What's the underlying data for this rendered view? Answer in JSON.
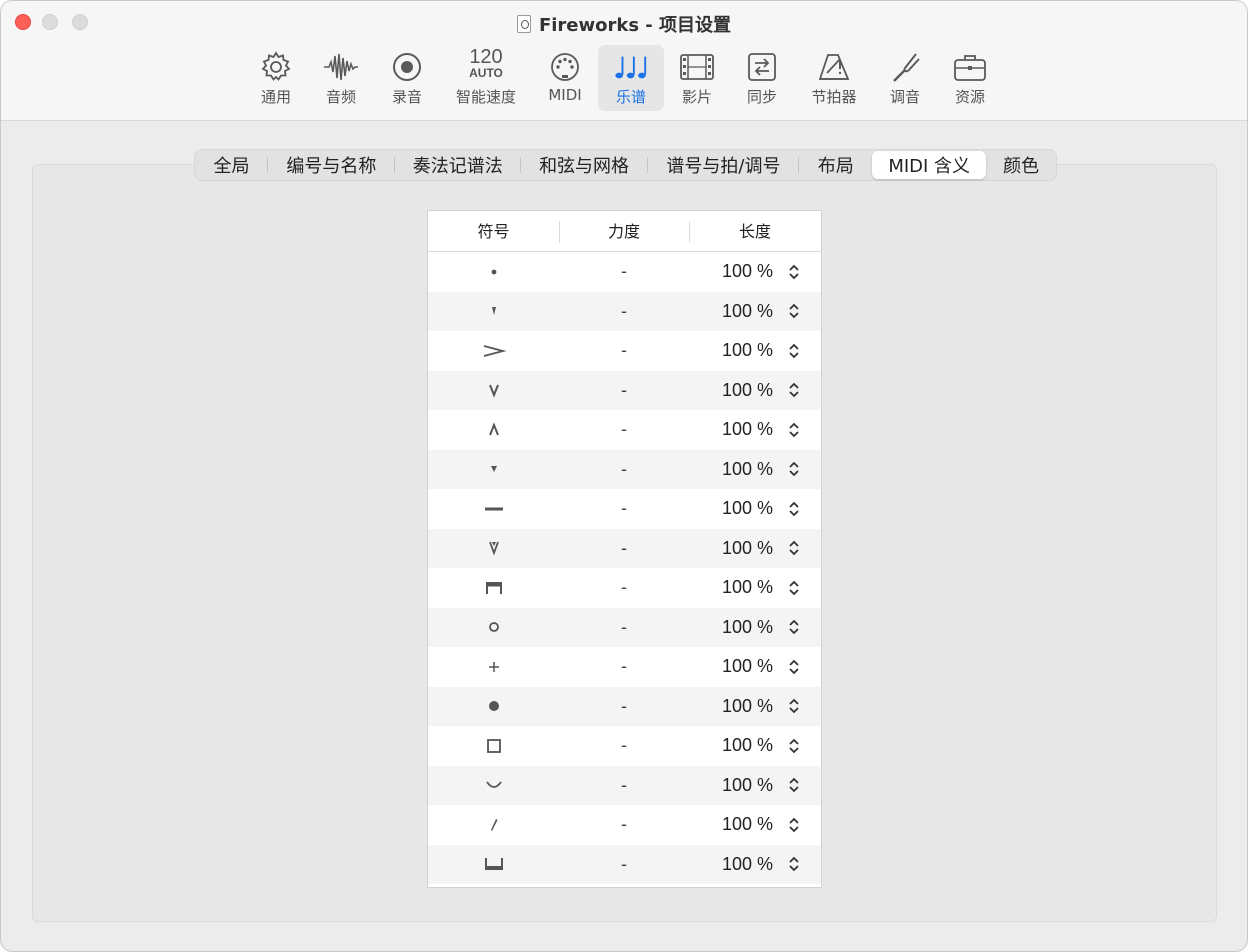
{
  "window": {
    "title": "Fireworks - 项目设置"
  },
  "toolbar": {
    "items": [
      {
        "id": "general",
        "label": "通用",
        "icon": "gear-icon"
      },
      {
        "id": "audio",
        "label": "音频",
        "icon": "waveform-icon"
      },
      {
        "id": "recording",
        "label": "录音",
        "icon": "record-icon"
      },
      {
        "id": "tempo",
        "label": "智能速度",
        "icon_text_top": "120",
        "icon_text_bottom": "AUTO"
      },
      {
        "id": "midi",
        "label": "MIDI",
        "icon": "midi-port-icon"
      },
      {
        "id": "score",
        "label": "乐谱",
        "icon": "music-notes-icon",
        "active": true
      },
      {
        "id": "movie",
        "label": "影片",
        "icon": "film-icon"
      },
      {
        "id": "sync",
        "label": "同步",
        "icon": "sync-icon"
      },
      {
        "id": "metronome",
        "label": "节拍器",
        "icon": "metronome-icon"
      },
      {
        "id": "tuning",
        "label": "调音",
        "icon": "tuning-fork-icon"
      },
      {
        "id": "assets",
        "label": "资源",
        "icon": "briefcase-icon"
      }
    ]
  },
  "tabs": {
    "items": [
      {
        "label": "全局"
      },
      {
        "label": "编号与名称"
      },
      {
        "label": "奏法记谱法"
      },
      {
        "label": "和弦与网格"
      },
      {
        "label": "谱号与拍/调号"
      },
      {
        "label": "布局"
      },
      {
        "label": "MIDI 含义",
        "selected": true
      },
      {
        "label": "颜色"
      }
    ]
  },
  "table": {
    "headers": {
      "symbol": "符号",
      "velocity": "力度",
      "length": "长度"
    },
    "rows": [
      {
        "symbol": "staccato-dot",
        "velocity": "-",
        "length": "100 %"
      },
      {
        "symbol": "staccatissimo-wedge",
        "velocity": "-",
        "length": "100 %"
      },
      {
        "symbol": "accent",
        "velocity": "-",
        "length": "100 %"
      },
      {
        "symbol": "marcato-down",
        "velocity": "-",
        "length": "100 %"
      },
      {
        "symbol": "marcato-up",
        "velocity": "-",
        "length": "100 %"
      },
      {
        "symbol": "spiccato-triangle",
        "velocity": "-",
        "length": "100 %"
      },
      {
        "symbol": "tenuto",
        "velocity": "-",
        "length": "100 %"
      },
      {
        "symbol": "marcato-staccato",
        "velocity": "-",
        "length": "100 %"
      },
      {
        "symbol": "down-bow",
        "velocity": "-",
        "length": "100 %"
      },
      {
        "symbol": "harmonic-circle",
        "velocity": "-",
        "length": "100 %"
      },
      {
        "symbol": "stopped-plus",
        "velocity": "-",
        "length": "100 %"
      },
      {
        "symbol": "filled-dot",
        "velocity": "-",
        "length": "100 %"
      },
      {
        "symbol": "square",
        "velocity": "-",
        "length": "100 %"
      },
      {
        "symbol": "arc-breath",
        "velocity": "-",
        "length": "100 %"
      },
      {
        "symbol": "stroke",
        "velocity": "-",
        "length": "100 %"
      },
      {
        "symbol": "bracket-bottom",
        "velocity": "-",
        "length": "100 %"
      }
    ]
  },
  "colors": {
    "accent": "#1a73e8",
    "close_button": "#fe5f57"
  }
}
